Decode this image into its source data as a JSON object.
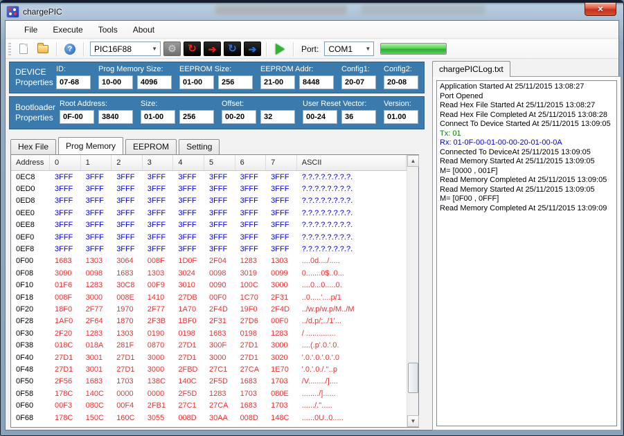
{
  "colors": {
    "panel_blue": "#3A7AAD",
    "hex_blue": "#0000EE",
    "hex_red": "#F03030",
    "tx_green": "#008000",
    "rx_blue": "#0000EE",
    "progress_green": "#3FBF3F",
    "close_red": "#C3311D"
  },
  "window": {
    "title": "chargePIC",
    "close_glyph": "✕"
  },
  "menu": {
    "items": [
      "File",
      "Execute",
      "Tools",
      "About"
    ]
  },
  "toolbar": {
    "device_select_value": "PIC16F88",
    "port_label": "Port:",
    "port_select_value": "COM1",
    "progress_percent": 100,
    "icons": [
      "new-file-icon",
      "open-file-icon",
      "help-icon",
      "gear-icon",
      "red-refresh-icon",
      "red-arrow-icon",
      "blue-refresh-icon",
      "blue-arrow-icon",
      "play-icon"
    ]
  },
  "device_panel": {
    "title_line1": "DEVICE",
    "title_line2": "Properties",
    "fields": [
      {
        "label": "ID:",
        "values": [
          "07-68"
        ]
      },
      {
        "label": "Prog Memory Size:",
        "values": [
          "10-00",
          "4096"
        ]
      },
      {
        "label": "EEPROM Size:",
        "values": [
          "01-00",
          "256"
        ]
      },
      {
        "label": "EEPROM Addr:",
        "values": [
          "21-00",
          "8448"
        ]
      },
      {
        "label": "Config1:",
        "values": [
          "20-07"
        ]
      },
      {
        "label": "Config2:",
        "values": [
          "20-08"
        ]
      }
    ]
  },
  "bootloader_panel": {
    "title_line1": "Bootloader",
    "title_line2": "Properties",
    "fields": [
      {
        "label": "Root Address:",
        "values": [
          "0F-00",
          "3840"
        ]
      },
      {
        "label": "Size:",
        "values": [
          "01-00",
          "256"
        ]
      },
      {
        "label": "Offset:",
        "values": [
          "00-20",
          "32"
        ]
      },
      {
        "label": "User Reset Vector:",
        "values": [
          "00-24",
          "36"
        ]
      },
      {
        "label": "Version:",
        "values": [
          "01.00"
        ]
      }
    ]
  },
  "tabs": [
    {
      "label": "Hex File",
      "active": false
    },
    {
      "label": "Prog Memory",
      "active": true
    },
    {
      "label": "EEPROM",
      "active": false
    },
    {
      "label": "Setting",
      "active": false
    }
  ],
  "memory_table": {
    "headers": [
      "Address",
      "0",
      "1",
      "2",
      "3",
      "4",
      "5",
      "6",
      "7",
      "ASCII"
    ],
    "rows": [
      {
        "address": "0EC8",
        "color": "blue",
        "values": [
          "3FFF",
          "3FFF",
          "3FFF",
          "3FFF",
          "3FFF",
          "3FFF",
          "3FFF",
          "3FFF"
        ],
        "ascii": "?.?.?.?.?.?.?.?."
      },
      {
        "address": "0ED0",
        "color": "blue",
        "values": [
          "3FFF",
          "3FFF",
          "3FFF",
          "3FFF",
          "3FFF",
          "3FFF",
          "3FFF",
          "3FFF"
        ],
        "ascii": "?.?.?.?.?.?.?.?."
      },
      {
        "address": "0ED8",
        "color": "blue",
        "values": [
          "3FFF",
          "3FFF",
          "3FFF",
          "3FFF",
          "3FFF",
          "3FFF",
          "3FFF",
          "3FFF"
        ],
        "ascii": "?.?.?.?.?.?.?.?."
      },
      {
        "address": "0EE0",
        "color": "blue",
        "values": [
          "3FFF",
          "3FFF",
          "3FFF",
          "3FFF",
          "3FFF",
          "3FFF",
          "3FFF",
          "3FFF"
        ],
        "ascii": "?.?.?.?.?.?.?.?."
      },
      {
        "address": "0EE8",
        "color": "blue",
        "values": [
          "3FFF",
          "3FFF",
          "3FFF",
          "3FFF",
          "3FFF",
          "3FFF",
          "3FFF",
          "3FFF"
        ],
        "ascii": "?.?.?.?.?.?.?.?."
      },
      {
        "address": "0EF0",
        "color": "blue",
        "values": [
          "3FFF",
          "3FFF",
          "3FFF",
          "3FFF",
          "3FFF",
          "3FFF",
          "3FFF",
          "3FFF"
        ],
        "ascii": "?.?.?.?.?.?.?.?."
      },
      {
        "address": "0EF8",
        "color": "blue",
        "values": [
          "3FFF",
          "3FFF",
          "3FFF",
          "3FFF",
          "3FFF",
          "3FFF",
          "3FFF",
          "3FFF"
        ],
        "ascii": "?.?.?.?.?.?.?.?."
      },
      {
        "address": "0F00",
        "color": "red",
        "values": [
          "1683",
          "1303",
          "3064",
          "008F",
          "1D0F",
          "2F04",
          "1283",
          "1303"
        ],
        "ascii": "....0d..../....."
      },
      {
        "address": "0F08",
        "color": "red",
        "values": [
          "3090",
          "0098",
          "1683",
          "1303",
          "3024",
          "0098",
          "3019",
          "0099"
        ],
        "ascii": "0.......0$..0..."
      },
      {
        "address": "0F10",
        "color": "red",
        "values": [
          "01F6",
          "1283",
          "30C8",
          "00F9",
          "3010",
          "0090",
          "100C",
          "3000"
        ],
        "ascii": "....0...0.....0."
      },
      {
        "address": "0F18",
        "color": "red",
        "values": [
          "008F",
          "3000",
          "008E",
          "1410",
          "27DB",
          "00F0",
          "1C70",
          "2F31"
        ],
        "ascii": "..0.....'....p/1"
      },
      {
        "address": "0F20",
        "color": "red",
        "values": [
          "18F0",
          "2F77",
          "1970",
          "2F77",
          "1A70",
          "2F4D",
          "19F0",
          "2F4D"
        ],
        "ascii": "../w.p/w.p/M../M"
      },
      {
        "address": "0F28",
        "color": "red",
        "values": [
          "1AF0",
          "2F64",
          "1870",
          "2F3B",
          "1BF0",
          "2F31",
          "27D6",
          "00F0"
        ],
        "ascii": "../d.p/;../1'..."
      },
      {
        "address": "0F30",
        "color": "red",
        "values": [
          "2F20",
          "1283",
          "1303",
          "0190",
          "0198",
          "1683",
          "0198",
          "1283"
        ],
        "ascii": "/ .............."
      },
      {
        "address": "0F38",
        "color": "red",
        "values": [
          "018C",
          "018A",
          "281F",
          "0870",
          "27D1",
          "300F",
          "27D1",
          "3000"
        ],
        "ascii": "....(.p'.0.'.0."
      },
      {
        "address": "0F40",
        "color": "red",
        "values": [
          "27D1",
          "3001",
          "27D1",
          "3000",
          "27D1",
          "3000",
          "27D1",
          "3020"
        ],
        "ascii": "'.0.'.0.'.0.'.0"
      },
      {
        "address": "0F48",
        "color": "red",
        "values": [
          "27D1",
          "3001",
          "27D1",
          "3000",
          "2FBD",
          "27C1",
          "27CA",
          "1E70"
        ],
        "ascii": "'.0.'.0./.''..p"
      },
      {
        "address": "0F50",
        "color": "red",
        "values": [
          "2F56",
          "1683",
          "1703",
          "138C",
          "140C",
          "2F5D",
          "1683",
          "1703"
        ],
        "ascii": "/V......../]...."
      },
      {
        "address": "0F58",
        "color": "red",
        "values": [
          "178C",
          "140C",
          "0000",
          "0000",
          "2F5D",
          "1283",
          "1703",
          "080E"
        ],
        "ascii": "......../]......"
      },
      {
        "address": "0F60",
        "color": "red",
        "values": [
          "00F3",
          "080C",
          "00F4",
          "2FB1",
          "27C1",
          "27CA",
          "1683",
          "1703"
        ],
        "ascii": "....../.''....."
      },
      {
        "address": "0F68",
        "color": "red",
        "values": [
          "178C",
          "150C",
          "160C",
          "3055",
          "008D",
          "30AA",
          "008D",
          "148C"
        ],
        "ascii": "......0U..0....."
      }
    ]
  },
  "log_panel": {
    "tab": "chargePICLog.txt",
    "lines": [
      {
        "text": "Application Started At 25/11/2015 13:08:27",
        "color": "black"
      },
      {
        "text": "Port Opened",
        "color": "black"
      },
      {
        "text": "Read Hex File Started At 25/11/2015 13:08:27",
        "color": "black"
      },
      {
        "text": "Read Hex File Completed At 25/11/2015 13:08:28",
        "color": "black"
      },
      {
        "text": "Connect To Device Started At 25/11/2015 13:09:05",
        "color": "black"
      },
      {
        "text": "Tx: 01",
        "color": "green"
      },
      {
        "text": "Rx: 01-0F-00-01-00-00-20-01-00-0A",
        "color": "blue"
      },
      {
        "text": "Connected To DeviceAt 25/11/2015 13:09:05",
        "color": "black"
      },
      {
        "text": "Read Memory Started At 25/11/2015 13:09:05",
        "color": "black"
      },
      {
        "text": "M= [0000 , 001F]",
        "color": "black"
      },
      {
        "text": "Read Memory Completed At 25/11/2015 13:09:05",
        "color": "black"
      },
      {
        "text": "Read Memory Started At 25/11/2015 13:09:05",
        "color": "black"
      },
      {
        "text": "M= [0F00 , 0FFF]",
        "color": "black"
      },
      {
        "text": "Read Memory Completed At 25/11/2015 13:09:09",
        "color": "black"
      }
    ]
  }
}
